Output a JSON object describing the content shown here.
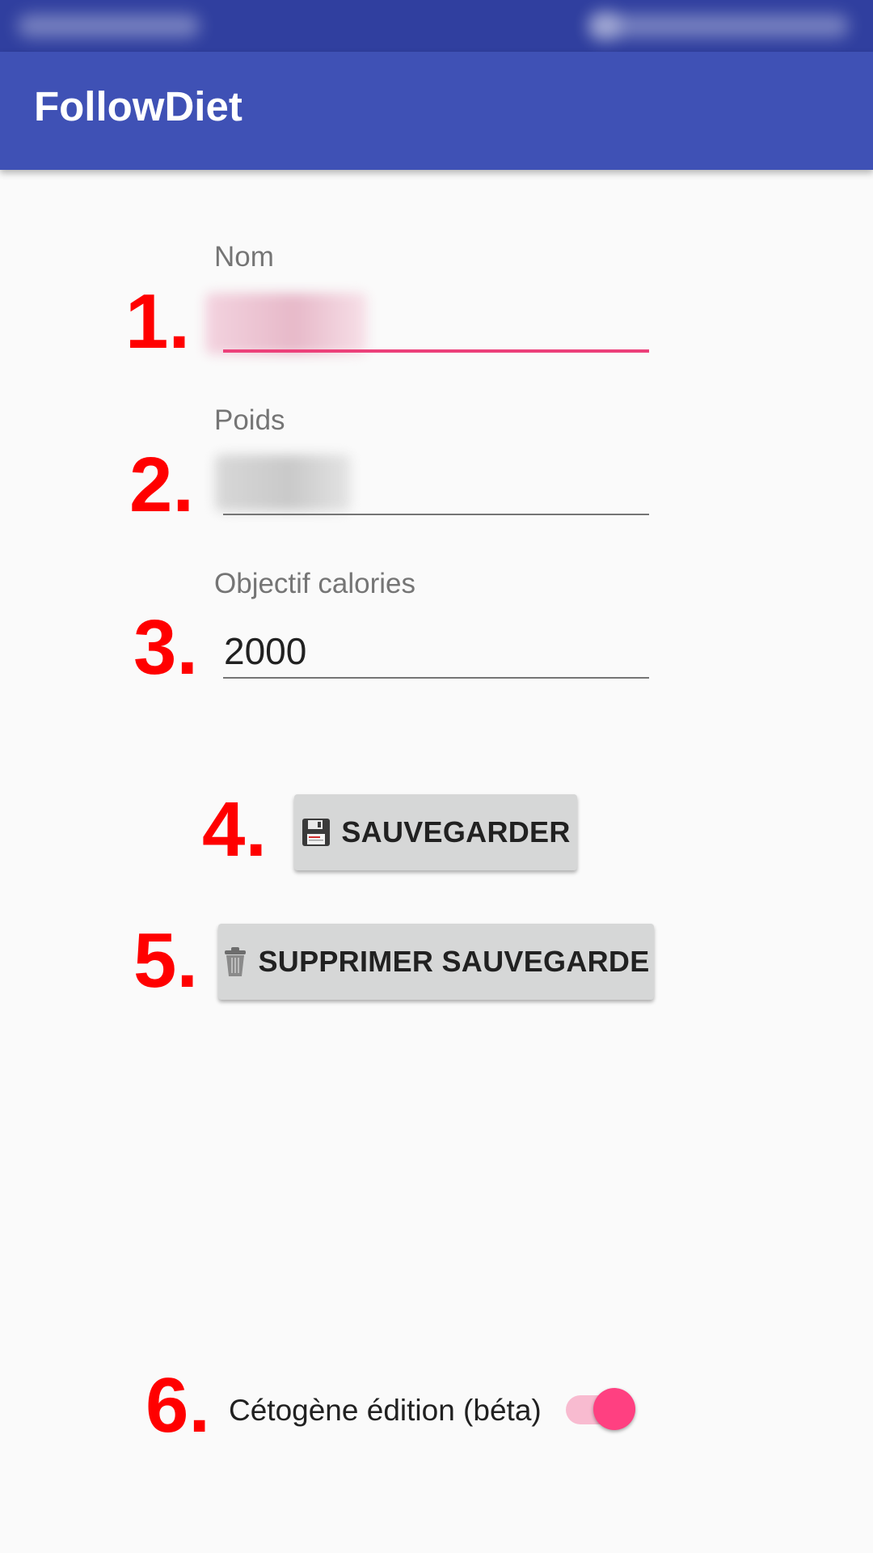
{
  "app": {
    "title": "FollowDiet"
  },
  "form": {
    "name": {
      "label": "Nom",
      "value_redacted": true
    },
    "weight": {
      "label": "Poids",
      "value_redacted": true
    },
    "calories": {
      "label": "Objectif calories",
      "value": "2000"
    }
  },
  "buttons": {
    "save": {
      "label": "SAUVEGARDER",
      "icon": "floppy-disk-icon"
    },
    "delete": {
      "label": "SUPPRIMER SAUVEGARDE",
      "icon": "trash-can-icon"
    }
  },
  "toggle": {
    "label": "Cétogène édition (béta)",
    "checked": true
  },
  "markers": [
    "1.",
    "2.",
    "3.",
    "4.",
    "5.",
    "6."
  ],
  "colors": {
    "status_bar": "#303f9f",
    "app_bar": "#3f51b5",
    "accent": "#ff4081",
    "focused_underline": "#ec407a",
    "button_bg": "#d6d7d7",
    "background": "#fafafa",
    "annotation": "#ff0000"
  }
}
